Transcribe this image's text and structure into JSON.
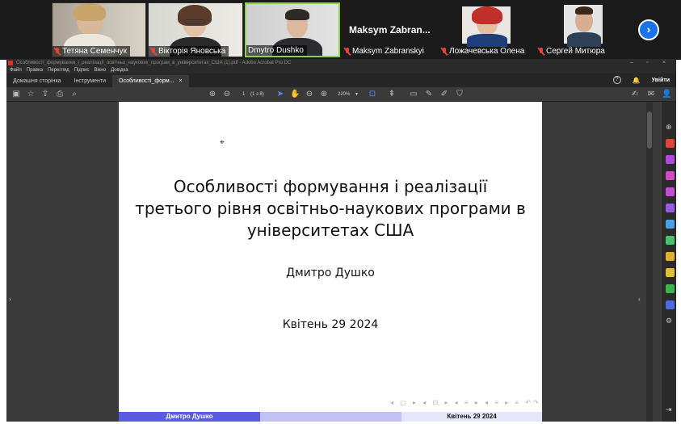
{
  "participants": [
    {
      "name": "Тетяна Семенчук",
      "muted": true
    },
    {
      "name": "Вікторія Яновська",
      "muted": true
    },
    {
      "name": "Dmytro Dushko",
      "muted": false,
      "active": true
    },
    {
      "name": "Maksym Zabranskyi",
      "display": "Maksym Zabran...",
      "muted": true,
      "video": false
    },
    {
      "name": "Ложачевська Олена",
      "muted": true
    },
    {
      "name": "Сергей Митюра",
      "muted": true
    }
  ],
  "next_page_label": "›",
  "app": {
    "window_title": "Особливості_формування_і_реалізації_освітньо_наукових_програм_в_університетах_США (1).pdf - Adobe Acrobat Pro DC",
    "menu": [
      "Файл",
      "Правка",
      "Перегляд",
      "Підпис",
      "Вікно",
      "Довідка"
    ],
    "tabs": [
      {
        "label": "Домашня сторінка"
      },
      {
        "label": "Інструменти"
      },
      {
        "label": "Особливості_форм...",
        "close": "×"
      }
    ],
    "sign_in": "Увійти",
    "toolbar": {
      "page_current": "1",
      "page_total": "(1 з 8)",
      "zoom": "220%"
    }
  },
  "slide": {
    "title_line1": "Особливості формування і реалізації",
    "title_line2": "третього рівня освітньо-наукових програми в",
    "title_line3": "університетах США",
    "author": "Дмитро Душко",
    "date": "Квітень 29 2024",
    "footer_author": "Дмитро Душко",
    "footer_date": "Квітень 29 2024",
    "nav_symbols": "◂ ▢ ▸ ◂ ⊡ ▸ ◂ ≡ ▸ ◂ ≡ ▸ ≡ ↶↷"
  },
  "colors": {
    "footer_left": "#5b5be0",
    "footer_mid": "#c2c2f5",
    "footer_right": "#e6e6fa",
    "accent_blue": "#1a73e8",
    "active_border": "#8bd14a",
    "mic_off": "#e0443a"
  }
}
